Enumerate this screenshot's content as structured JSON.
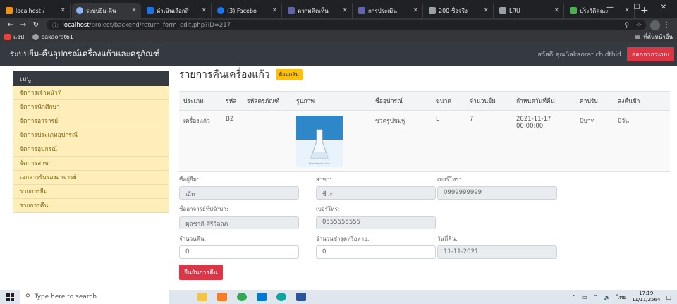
{
  "browser": {
    "tabs": [
      {
        "label": "localhost / ",
        "color": "#f29111"
      },
      {
        "label": "ระบบยืม-คืน",
        "color": "#8ab4f8",
        "active": true
      },
      {
        "label": "ดำเนินเลือกสิ",
        "color": "#1a73e8"
      },
      {
        "label": "(3) Facebo",
        "color": "#1877f2"
      },
      {
        "label": "ความคิดเห็น",
        "color": "#6264a7"
      },
      {
        "label": "การประเมิน",
        "color": "#6264a7"
      },
      {
        "label": "200 ชื่อจริง",
        "color": "#9aa0a6"
      },
      {
        "label": "LRU",
        "color": "#9aa0a6"
      },
      {
        "label": "ประวัติคณะ",
        "color": "#4caf50"
      }
    ],
    "new_tab": "+",
    "url_host": "localhost",
    "url_path": "/project/backend/return_form_edit.php?ID=217",
    "bookmarks": [
      {
        "label": "แอป",
        "color": "#ea4335"
      },
      {
        "label": "sakaorat61",
        "color": "#9aa0a6"
      }
    ],
    "bookmark_right": "ที่คั่นหน้าอื่น"
  },
  "app": {
    "brand": "ระบบยืม-คืนอุปกรณ์เครื่องแก้วและครุภัณฑ์",
    "welcome": "สวัสดี คุณSakaorat chidthid",
    "logout": "ออกจากระบบ"
  },
  "sidebar": {
    "header": "เมนู",
    "items": [
      "จัดการเจ้าหน้าที่",
      "จัดการนักศึกษา",
      "จัดการอาจารย์",
      "จัดการประเภทอุปกรณ์",
      "จัดการอุปกรณ์",
      "จัดการสาขา",
      "เอกสารรับรองอาจารย์",
      "รายการยืม",
      "รายการคืน"
    ]
  },
  "main": {
    "title": "รายการคืนเครื่องแก้ว",
    "back_button": "ย้อนกลับ",
    "table": {
      "headers": [
        "ประเภท",
        "รหัส",
        "รหัสครุภัณฑ์",
        "รูปภาพ",
        "ชื่ออุปกรณ์",
        "ขนาด",
        "จำนวนยืม",
        "กำหนดวันที่คืน",
        "ค่าปรับ",
        "ส่งคืนช้า"
      ],
      "row": {
        "type": "เครื่องแก้ว",
        "code": "B2",
        "asset_code": "",
        "image_caption": "Erlenmeyer Flask",
        "name": "ขวดรูปชมพู่",
        "size": "L",
        "quantity": "7",
        "due_date": "2021-11-17 00:00:00",
        "fine": "0บาท",
        "late": "0วัน"
      }
    },
    "form": {
      "borrower_label": "ชื่อผู้ยืม:",
      "borrower_value": "ณัท",
      "branch_label": "สาขา:",
      "branch_value": "ชีวะ",
      "phone_label": "เบอร์โทร:",
      "phone_value": "0999999999",
      "advisor_label": "ชื่ออาจารย์ที่ปรึกษา:",
      "advisor_value": "ดุลชาติ ศิริวัลลภ",
      "advisor_phone_label": "เบอร์โทร:",
      "advisor_phone_value": "0555555555",
      "return_qty_label": "จำนวนคืน:",
      "return_qty_value": "0",
      "damaged_label": "จำนวนชำรุดหรือหาย:",
      "damaged_value": "0",
      "return_date_label": "วันที่คืน:",
      "return_date_value": "11-11-2021",
      "confirm_button": "ยืนยันการคืน"
    }
  },
  "taskbar": {
    "search_placeholder": "Type here to search",
    "tray_lang": "ไทย",
    "time": "17:19",
    "date": "11/11/2564"
  }
}
